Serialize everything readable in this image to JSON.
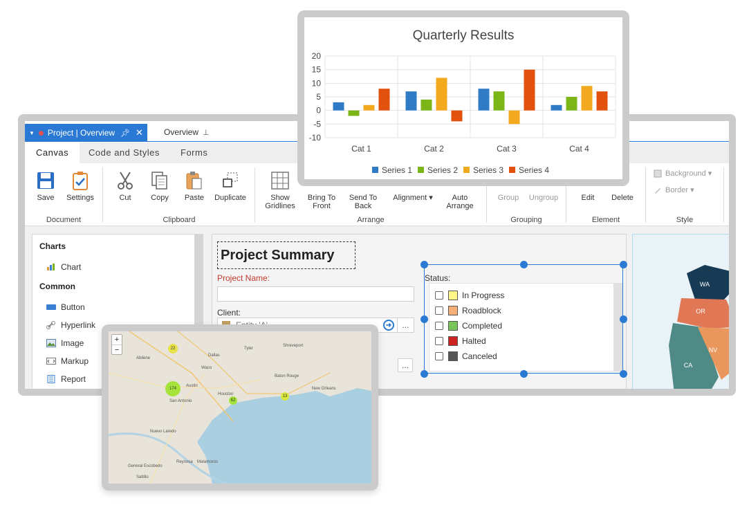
{
  "tabs": {
    "active_label": "Project | Overview",
    "second_label": "Overview"
  },
  "ribbon_tabs": [
    "Canvas",
    "Code and Styles",
    "Forms"
  ],
  "ribbon": {
    "document": {
      "label": "Document",
      "save": "Save",
      "settings": "Settings"
    },
    "clipboard": {
      "label": "Clipboard",
      "cut": "Cut",
      "copy": "Copy",
      "paste": "Paste",
      "duplicate": "Duplicate"
    },
    "arrange": {
      "label": "Arrange",
      "show_gridlines_1": "Show",
      "show_gridlines_2": "Gridlines",
      "bring_front_1": "Bring To",
      "bring_front_2": "Front",
      "send_back_1": "Send To",
      "send_back_2": "Back",
      "alignment": "Alignment ▾",
      "auto_arrange_1": "Auto",
      "auto_arrange_2": "Arrange"
    },
    "grouping": {
      "label": "Grouping",
      "group": "Group",
      "ungroup": "Ungroup"
    },
    "element": {
      "label": "Element",
      "edit": "Edit",
      "delete": "Delete"
    },
    "style": {
      "label": "Style",
      "background": "Background ▾",
      "border": "Border ▾"
    }
  },
  "toolbox": {
    "charts_heading": "Charts",
    "chart": "Chart",
    "common_heading": "Common",
    "button": "Button",
    "hyperlink": "Hyperlink",
    "image": "Image",
    "markup": "Markup",
    "report": "Report"
  },
  "canvas": {
    "title": "Project Summary",
    "project_name_label": "Project Name:",
    "client_label": "Client:",
    "client_value": "Entity 'A'",
    "more": "...",
    "status_label": "Status:",
    "status_options": [
      {
        "label": "In Progress",
        "color": "#fff68a"
      },
      {
        "label": "Roadblock",
        "color": "#f5b07a"
      },
      {
        "label": "Completed",
        "color": "#7ac55a"
      },
      {
        "label": "Halted",
        "color": "#cc2222"
      },
      {
        "label": "Canceled",
        "color": "#555555"
      }
    ]
  },
  "states_map": {
    "labels": [
      "WA",
      "OR",
      "NV",
      "CA"
    ]
  },
  "chart_data": {
    "type": "bar",
    "title": "Quarterly Results",
    "categories": [
      "Cat 1",
      "Cat 2",
      "Cat 3",
      "Cat 4"
    ],
    "series": [
      {
        "name": "Series 1",
        "color": "#2f7bc6",
        "values": [
          3,
          7,
          8,
          2
        ]
      },
      {
        "name": "Series 2",
        "color": "#7cb518",
        "values": [
          -2,
          4,
          7,
          5
        ]
      },
      {
        "name": "Series 3",
        "color": "#f2a91d",
        "values": [
          2,
          12,
          -5,
          9
        ]
      },
      {
        "name": "Series 4",
        "color": "#e2510e",
        "values": [
          8,
          -4,
          15,
          7
        ]
      }
    ],
    "ylim": [
      -10,
      20
    ],
    "yticks": [
      -10,
      -5,
      0,
      5,
      10,
      15,
      20
    ],
    "legend": "bottom",
    "grid": true
  },
  "city_map": {
    "zoom_in": "+",
    "zoom_out": "−",
    "clusters": [
      {
        "count": "22",
        "color": "#e8e24a"
      },
      {
        "count": "174",
        "color": "#a6e33a"
      },
      {
        "count": "62",
        "color": "#a6e33a"
      },
      {
        "count": "13",
        "color": "#d9e83a"
      }
    ],
    "cities": [
      "Dallas",
      "Austin",
      "San Antonio",
      "Houston",
      "Baton Rouge",
      "New Orleans",
      "Nuevo Laredo",
      "Reynosa",
      "Matamoros",
      "General Escobedo",
      "Saltillo",
      "Waco",
      "Tyler",
      "Shreveport",
      "Abilene"
    ]
  }
}
